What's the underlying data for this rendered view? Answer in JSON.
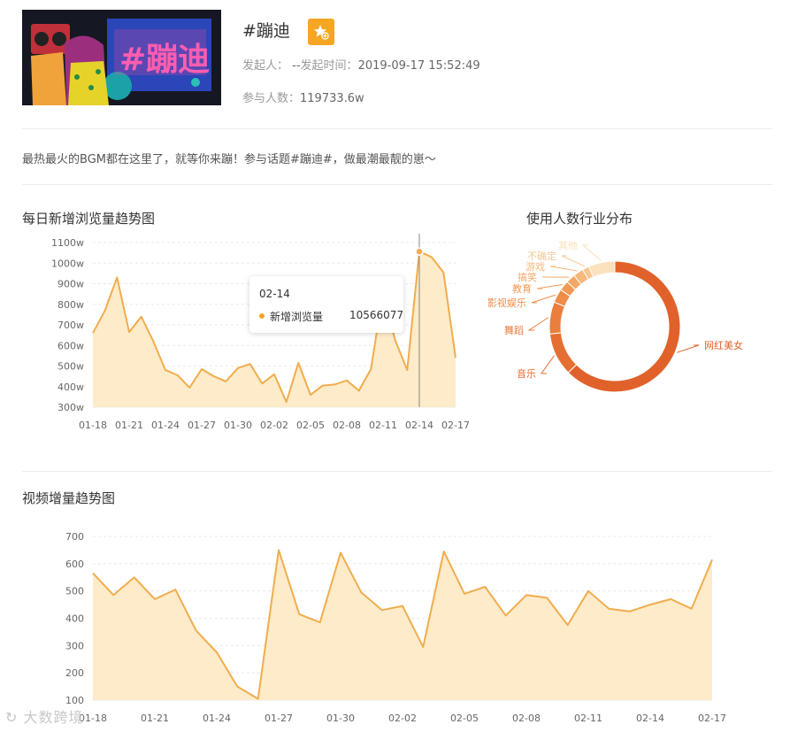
{
  "topic": {
    "title": "#蹦迪",
    "banner_text": "#蹦迪",
    "initiator_label": "发起人：",
    "initiator_value": "--",
    "start_time_label": "发起时间：",
    "start_time_value": "2019-09-17 15:52:49",
    "participants_label": "参与人数：",
    "participants_value": "119733.6w",
    "description": "最热最火的BGM都在这里了，就等你来蹦！参与话题#蹦迪#，做最潮最靓的崽～"
  },
  "icons": {
    "favorite": "star-plus-icon",
    "watermark": "logo-icon"
  },
  "colors": {
    "accent": "#f5a623",
    "line": "#f0ad4e",
    "area": "#fdebc9",
    "donut_main": "#e0622a"
  },
  "sections": {
    "daily_views_title": "每日新增浏览量趋势图",
    "industry_title": "使用人数行业分布",
    "video_growth_title": "视频增量趋势图"
  },
  "tooltip": {
    "date": "02-14",
    "series": "新增浏览量",
    "value": "10566077"
  },
  "watermark": "大数跨境",
  "chart_data": [
    {
      "type": "area",
      "x_tick_labels": [
        "01-18",
        "01-21",
        "01-24",
        "01-27",
        "01-30",
        "02-02",
        "02-05",
        "02-08",
        "02-11",
        "02-14",
        "02-17"
      ],
      "y_tick_labels": [
        "300w",
        "400w",
        "500w",
        "600w",
        "700w",
        "800w",
        "900w",
        "1000w",
        "1100w"
      ],
      "ylim": [
        300,
        1100
      ],
      "values": [
        660,
        770,
        930,
        665,
        740,
        620,
        480,
        455,
        395,
        485,
        450,
        425,
        490,
        510,
        415,
        460,
        325,
        515,
        360,
        405,
        410,
        430,
        380,
        485,
        860,
        625,
        480,
        1056,
        1030,
        955,
        540
      ],
      "highlight_index": 27
    },
    {
      "type": "pie",
      "donut": true,
      "slices": [
        {
          "label": "网红美女",
          "value": 62.6,
          "color": "#e0622a"
        },
        {
          "label": "音乐",
          "value": 10.6,
          "color": "#e56f33"
        },
        {
          "label": "舞蹈",
          "value": 7.9,
          "color": "#ea7e3d"
        },
        {
          "label": "影视娱乐",
          "value": 3.4,
          "color": "#ee8c48"
        },
        {
          "label": "教育",
          "value": 2.5,
          "color": "#f19a55"
        },
        {
          "label": "搞笑",
          "value": 2.3,
          "color": "#f4a866"
        },
        {
          "label": "游戏",
          "value": 2.5,
          "color": "#f6b87b"
        },
        {
          "label": "不确定",
          "value": 1.7,
          "color": "#f8c892"
        },
        {
          "label": "其他",
          "value": 6.5,
          "color": "#fbe1bd"
        }
      ]
    },
    {
      "type": "area",
      "x_tick_labels": [
        "01-18",
        "01-21",
        "01-24",
        "01-27",
        "01-30",
        "02-02",
        "02-05",
        "02-08",
        "02-11",
        "02-14",
        "02-17"
      ],
      "y_tick_labels": [
        "100",
        "200",
        "300",
        "400",
        "500",
        "600",
        "700"
      ],
      "ylim": [
        100,
        700
      ],
      "values": [
        565,
        485,
        550,
        470,
        505,
        355,
        275,
        150,
        105,
        650,
        415,
        385,
        640,
        495,
        430,
        445,
        295,
        645,
        490,
        515,
        410,
        485,
        475,
        375,
        500,
        435,
        425,
        450,
        470,
        435,
        615
      ]
    }
  ]
}
